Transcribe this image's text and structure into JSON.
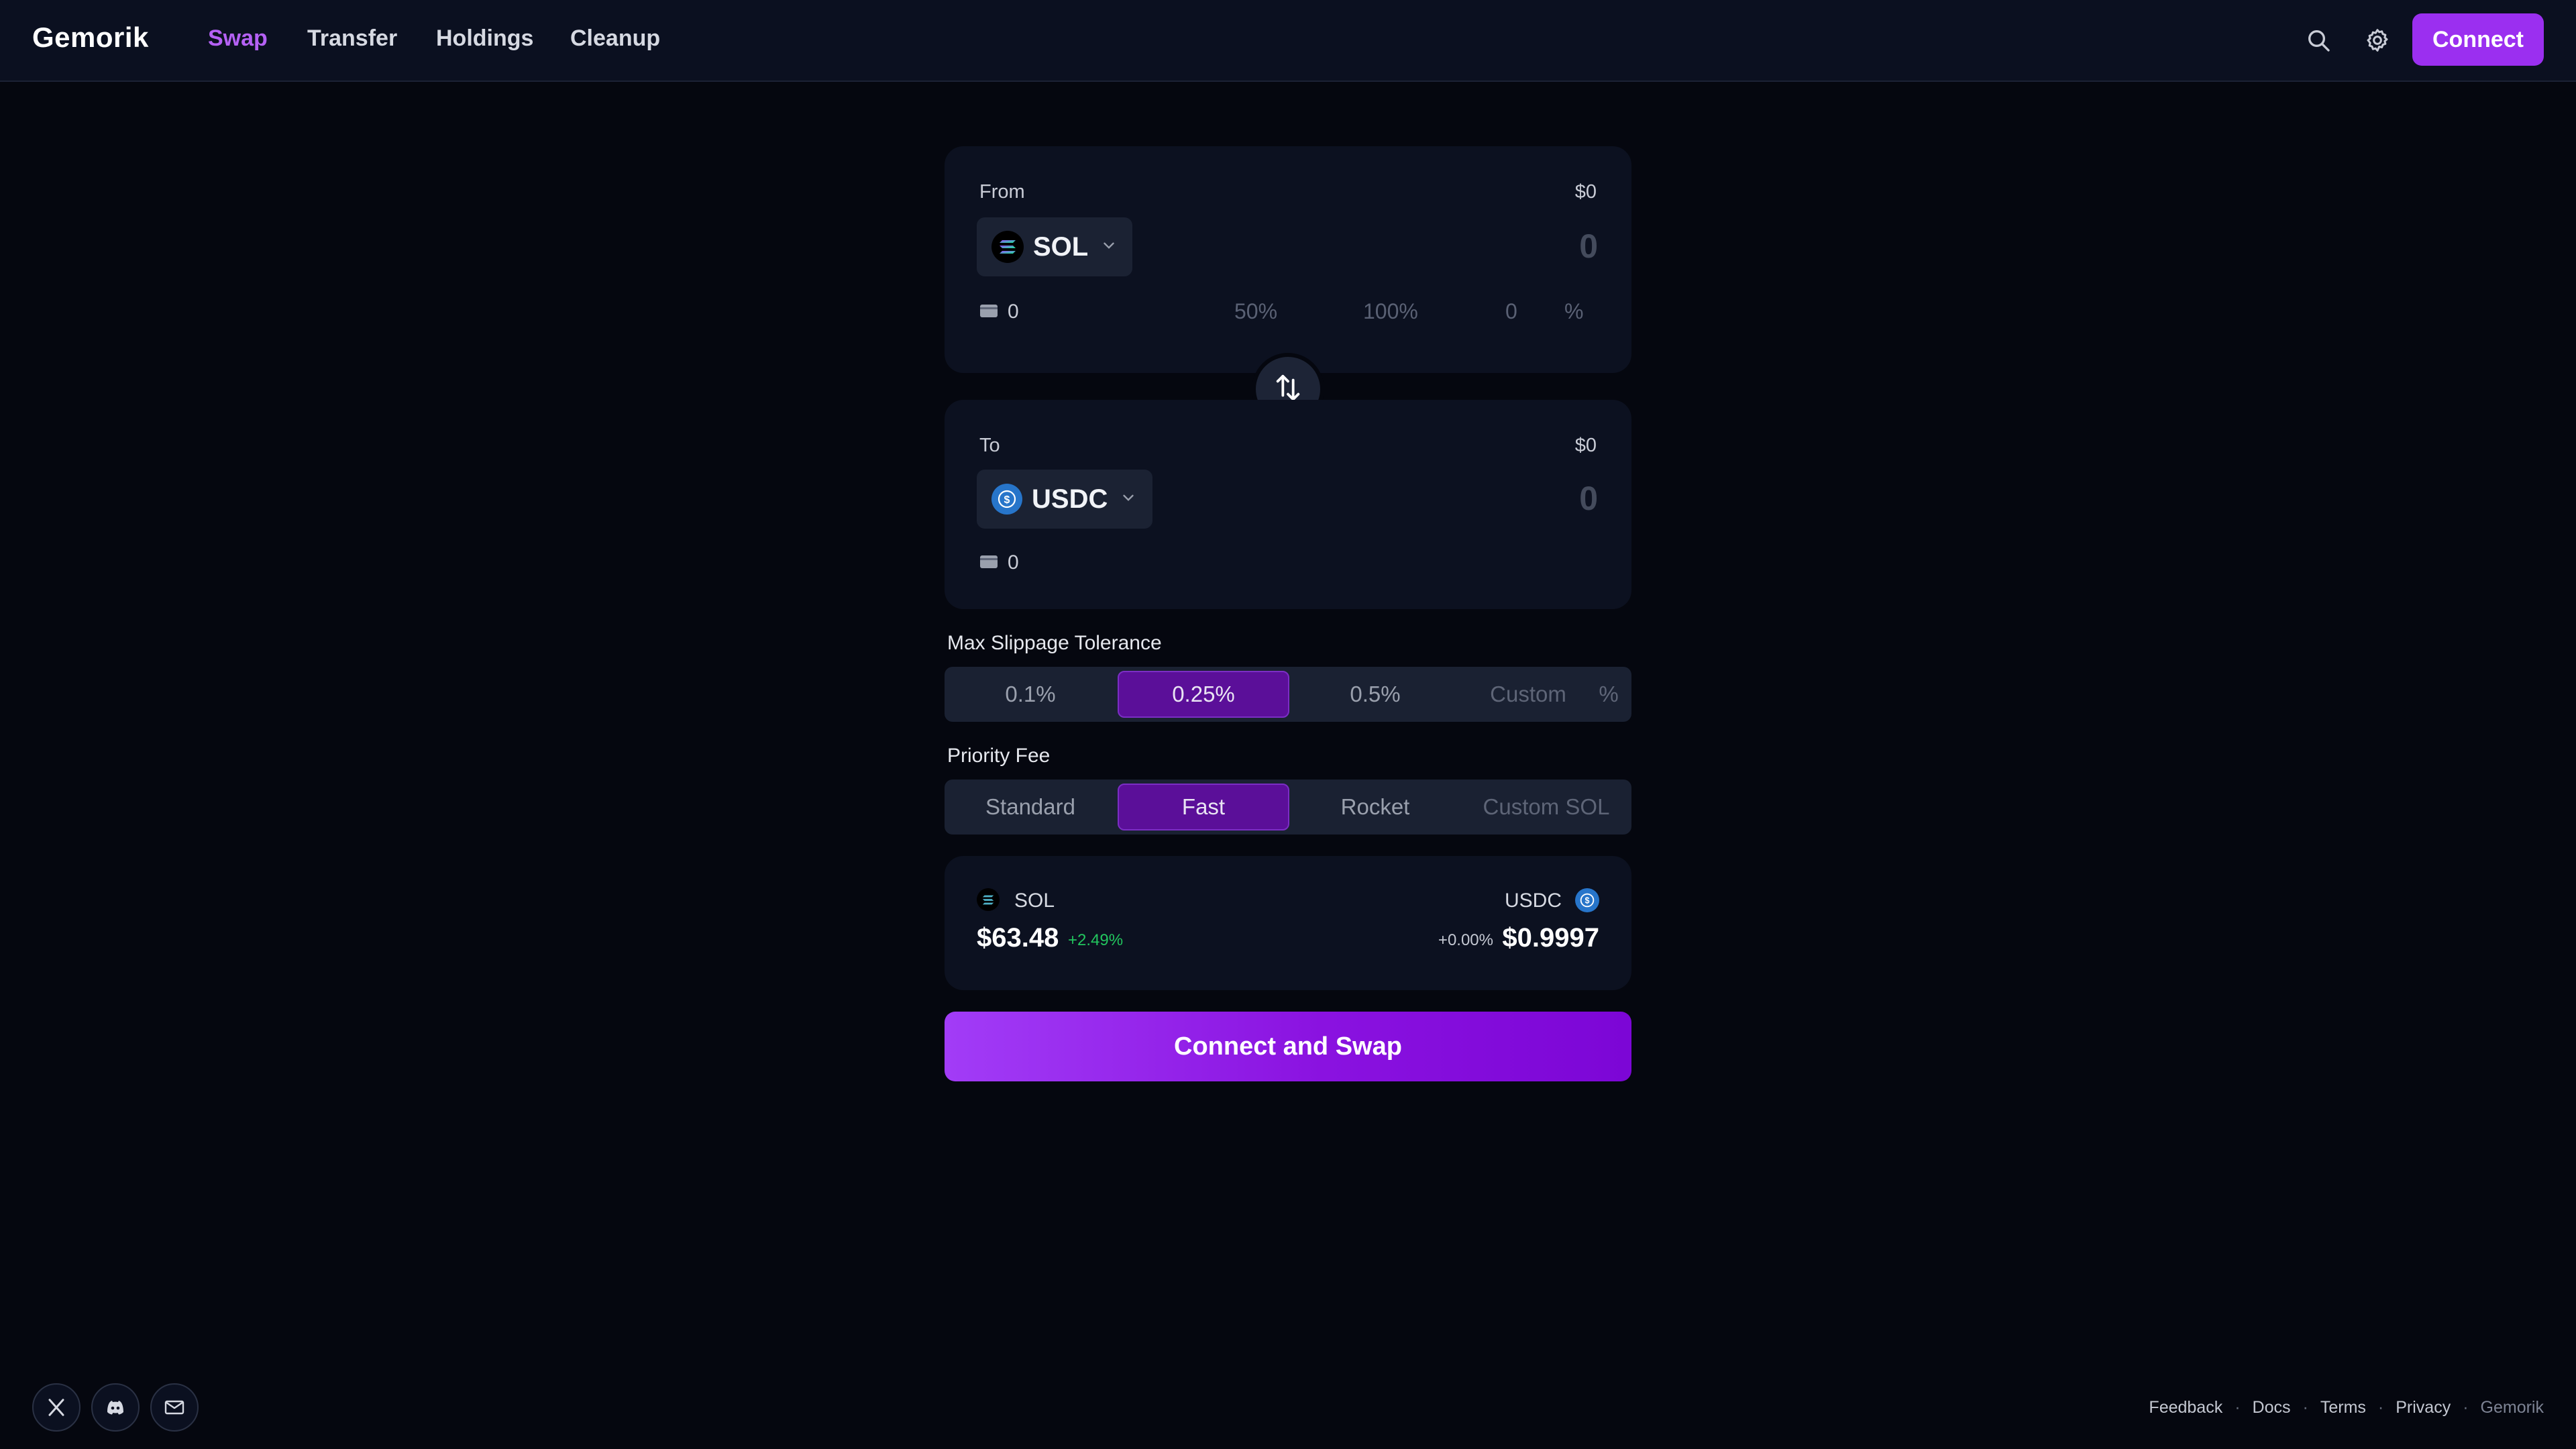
{
  "header": {
    "brand": "Gemorik",
    "nav": [
      {
        "label": "Swap",
        "active": true
      },
      {
        "label": "Transfer",
        "active": false
      },
      {
        "label": "Holdings",
        "active": false
      },
      {
        "label": "Cleanup",
        "active": false
      }
    ],
    "icons": [
      "search-icon",
      "gear-icon"
    ],
    "connect_label": "Connect"
  },
  "from": {
    "label": "From",
    "usd_value": "$0",
    "token": "SOL",
    "amount": "0",
    "balance": "0",
    "percent_options": [
      "50%",
      "100%"
    ],
    "custom_percent_value": "0",
    "percent_unit": "%"
  },
  "to": {
    "label": "To",
    "usd_value": "$0",
    "token": "USDC",
    "amount": "0",
    "balance": "0"
  },
  "slippage": {
    "title": "Max Slippage Tolerance",
    "options": [
      "0.1%",
      "0.25%",
      "0.5%"
    ],
    "selected": "0.25%",
    "custom_placeholder": "Custom",
    "unit": "%"
  },
  "priority_fee": {
    "title": "Priority Fee",
    "options": [
      "Standard",
      "Fast",
      "Rocket"
    ],
    "selected": "Fast",
    "custom_placeholder": "Custom SOL"
  },
  "prices": {
    "left": {
      "symbol": "SOL",
      "price": "$63.48",
      "change": "+2.49%"
    },
    "right": {
      "symbol": "USDC",
      "price": "$0.9997",
      "change": "+0.00%"
    }
  },
  "cta_label": "Connect and Swap",
  "footer": {
    "social": [
      "x-icon",
      "discord-icon",
      "mail-icon"
    ],
    "links": [
      "Feedback",
      "Docs",
      "Terms",
      "Privacy"
    ],
    "brand": "Gemorik"
  },
  "colors": {
    "accent": "#9b2ff0",
    "nav_active": "#b561f5",
    "positive": "#22c55e",
    "background": "#05070f"
  }
}
